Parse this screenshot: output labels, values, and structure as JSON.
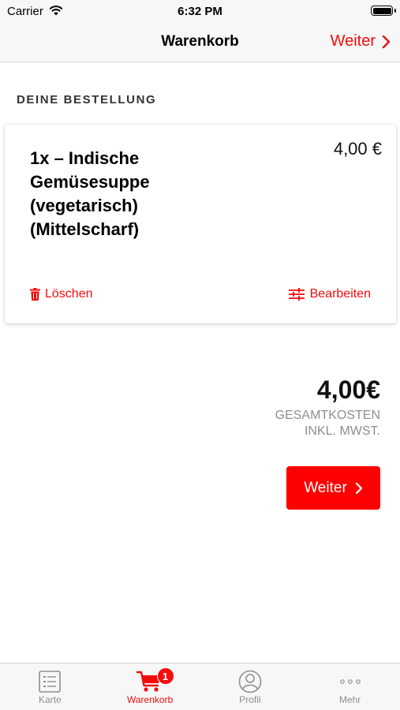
{
  "status_bar": {
    "carrier": "Carrier",
    "time": "6:32 PM"
  },
  "nav": {
    "title": "Warenkorb",
    "next_label": "Weiter"
  },
  "order": {
    "section_title": "DEINE BESTELLUNG",
    "items": [
      {
        "name": "1x – Indische Gemüsesuppe (vegetarisch) (Mittelscharf)",
        "price": "4,00 €",
        "delete_label": "Löschen",
        "edit_label": "Bearbeiten"
      }
    ]
  },
  "total": {
    "amount": "4,00€",
    "label_line1": "GESAMTKOSTEN",
    "label_line2": "INKL. MWST."
  },
  "checkout": {
    "button_label": "Weiter"
  },
  "tab_bar": {
    "tabs": [
      {
        "label": "Karte",
        "icon": "menu-list-icon"
      },
      {
        "label": "Warenkorb",
        "icon": "cart-icon",
        "badge": "1"
      },
      {
        "label": "Profil",
        "icon": "profile-icon"
      },
      {
        "label": "Mehr",
        "icon": "more-icon"
      }
    ]
  },
  "colors": {
    "accent": "#f20d0d",
    "button": "#ff0000",
    "muted_text": "#8e8e8e",
    "bar_background": "#f7f7f7"
  }
}
